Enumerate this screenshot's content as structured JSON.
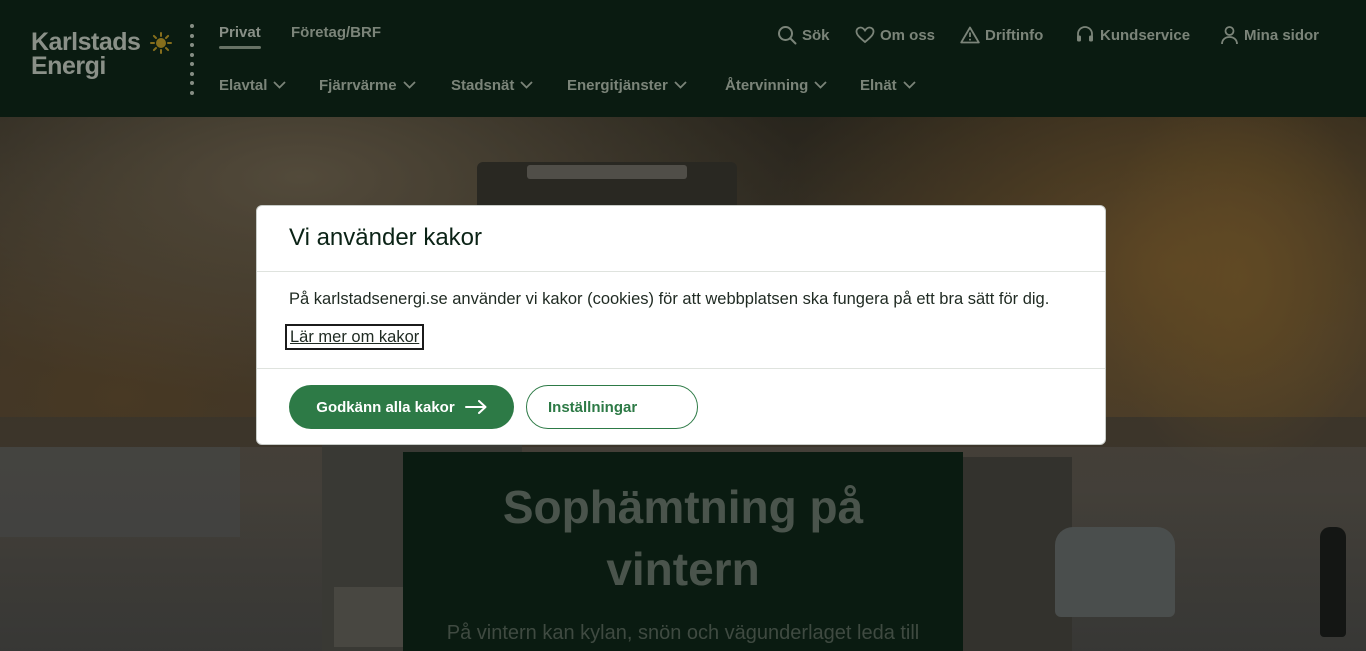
{
  "header": {
    "logo": {
      "line1": "Karlstads",
      "line2": "Energi"
    },
    "top_tabs": [
      {
        "label": "Privat",
        "active": true
      },
      {
        "label": "Företag/BRF",
        "active": false
      }
    ],
    "utility_links": [
      {
        "label": "Sök",
        "icon": "search-icon"
      },
      {
        "label": "Om oss",
        "icon": "heart-icon"
      },
      {
        "label": "Driftinfo",
        "icon": "warning-icon"
      },
      {
        "label": "Kundservice",
        "icon": "headset-icon"
      },
      {
        "label": "Mina sidor",
        "icon": "user-icon"
      }
    ],
    "main_nav": [
      {
        "label": "Elavtal"
      },
      {
        "label": "Fjärrvärme"
      },
      {
        "label": "Stadsnät"
      },
      {
        "label": "Energitjänster"
      },
      {
        "label": "Återvinning"
      },
      {
        "label": "Elnät"
      }
    ]
  },
  "hero": {
    "title_line1": "Sophämtning på",
    "title_line2": "vintern",
    "text": "På vintern kan kylan, snön och vägunderlaget leda till"
  },
  "cookie_modal": {
    "title": "Vi använder kakor",
    "body": "På karlstadsenergi.se använder vi kakor (cookies) för att webbplatsen ska fungera på ett bra sätt för dig.",
    "learn_more": "Lär mer om kakor",
    "accept_label": "Godkänn alla kakor",
    "settings_label": "Inställningar"
  },
  "colors": {
    "header_bg": "#0b2316",
    "brand_green": "#2d7a46",
    "sun": "#c9a227"
  }
}
